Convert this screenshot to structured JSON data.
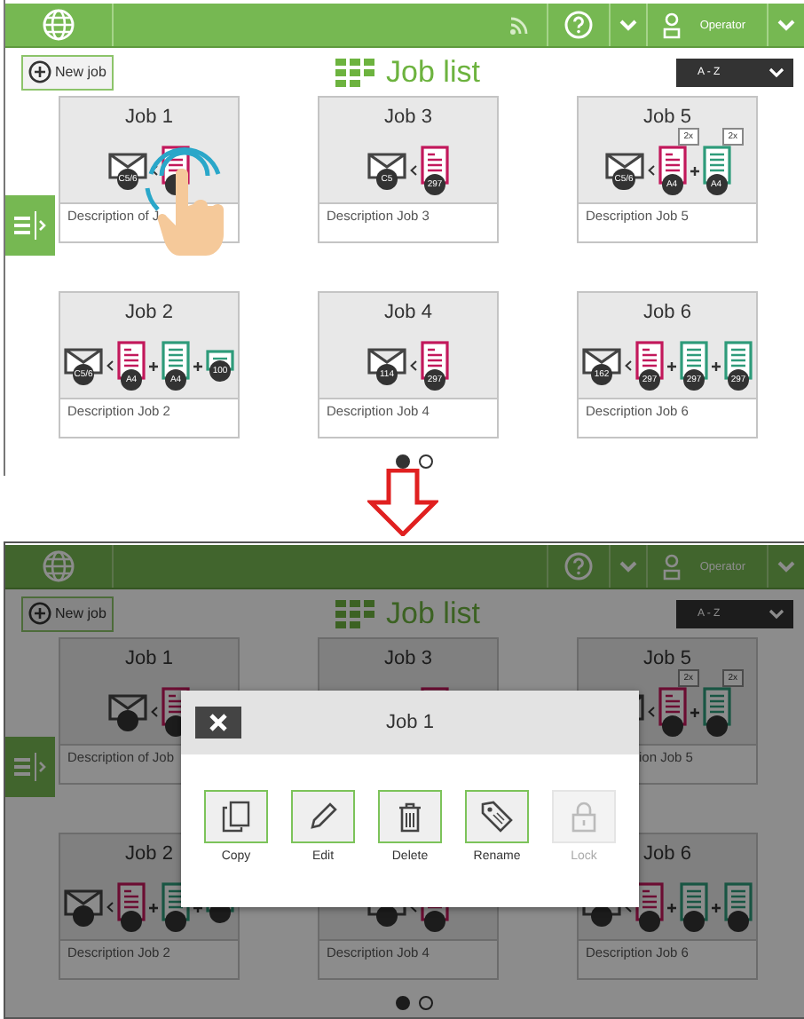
{
  "top_screen": {
    "header": {
      "connected": true,
      "user": "Operator"
    },
    "new_job": "New job",
    "title": "Job list",
    "sort": "A - Z",
    "tap_hint": true,
    "jobs": [
      {
        "title": "Job 1",
        "description": "Description of J",
        "envelope": "C5/6",
        "inserts": [
          {
            "kind": "letter"
          }
        ]
      },
      {
        "title": "Job 3",
        "description": "Description Job 3",
        "envelope": "C5",
        "inserts": [
          {
            "kind": "letter",
            "badge": "297"
          }
        ]
      },
      {
        "title": "Job 5",
        "description": "Description Job 5",
        "envelope": "C5/6",
        "inserts": [
          {
            "kind": "letter",
            "badge": "A4",
            "multiplier": "2x"
          },
          {
            "kind": "sheet",
            "badge": "A4",
            "multiplier": "2x"
          }
        ]
      },
      {
        "title": "Job 2",
        "description": "Description Job 2",
        "envelope": "C5/6",
        "inserts": [
          {
            "kind": "letter",
            "badge": "A4"
          },
          {
            "kind": "sheet",
            "badge": "A4"
          },
          {
            "kind": "reply",
            "badge": "100"
          }
        ]
      },
      {
        "title": "Job 4",
        "description": "Description Job 4",
        "envelope": "114",
        "inserts": [
          {
            "kind": "letter",
            "badge": "297"
          }
        ]
      },
      {
        "title": "Job 6",
        "description": "Description Job 6",
        "envelope": "162",
        "inserts": [
          {
            "kind": "letter",
            "badge": "297"
          },
          {
            "kind": "sheet",
            "badge": "297"
          },
          {
            "kind": "sheet",
            "badge": "297"
          }
        ]
      }
    ],
    "pages": [
      {
        "selected": true
      },
      {
        "selected": false
      }
    ]
  },
  "bottom_screen": {
    "header": {
      "connected": false,
      "user": "Operator"
    },
    "new_job": "New job",
    "title": "Job list",
    "sort": "A - Z",
    "jobs": [
      {
        "title": "Job 1",
        "description": "Description of Job",
        "inserts": [
          {
            "kind": "letter"
          }
        ]
      },
      {
        "title": "Job 3",
        "inserts": [
          {
            "kind": "letter"
          }
        ]
      },
      {
        "title": "Job 5",
        "description": "ion Job 5",
        "inserts": [
          {
            "kind": "letter",
            "multiplier": "2x"
          },
          {
            "kind": "sheet",
            "multiplier": "2x"
          }
        ]
      },
      {
        "title": "Job 2",
        "description": "Description Job 2",
        "inserts": [
          {
            "kind": "letter"
          },
          {
            "kind": "sheet"
          },
          {
            "kind": "reply"
          }
        ]
      },
      {
        "description": "Description Job 4",
        "inserts": [
          {
            "kind": "letter"
          }
        ]
      },
      {
        "title": "Job 6",
        "description": "Description Job 6",
        "inserts": [
          {
            "kind": "letter"
          },
          {
            "kind": "sheet"
          },
          {
            "kind": "sheet"
          }
        ]
      }
    ],
    "pages": [
      {
        "selected": true
      },
      {
        "selected": false
      }
    ],
    "dialog": {
      "title": "Job 1",
      "actions": [
        {
          "label": "Copy",
          "disabled": false
        },
        {
          "label": "Edit",
          "disabled": false
        },
        {
          "label": "Delete",
          "disabled": false
        },
        {
          "label": "Rename",
          "disabled": false
        },
        {
          "label": "Lock",
          "disabled": true
        }
      ]
    }
  }
}
